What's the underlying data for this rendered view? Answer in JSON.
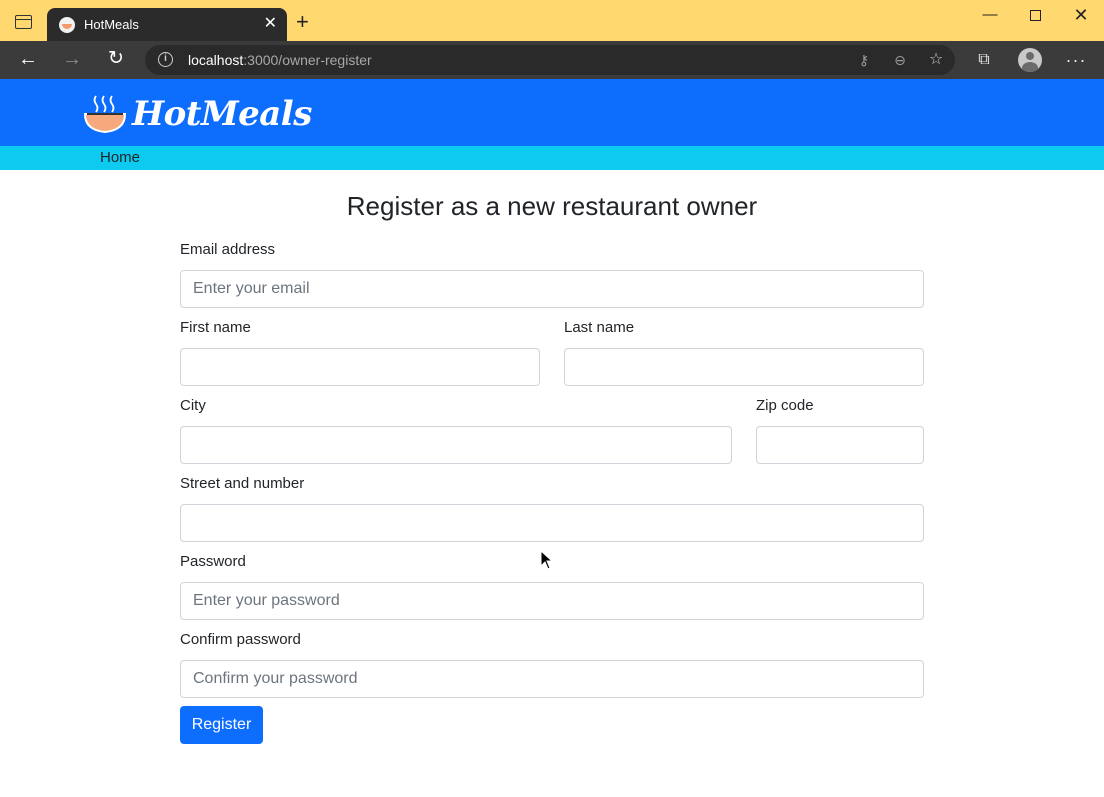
{
  "browser": {
    "tab_title": "HotMeals",
    "url_host": "localhost",
    "url_path": ":3000/owner-register"
  },
  "site": {
    "brand": "HotMeals",
    "nav": [
      {
        "label": "Home"
      }
    ]
  },
  "form": {
    "title": "Register as a new restaurant owner",
    "email": {
      "label": "Email address",
      "placeholder": "Enter your email"
    },
    "first_name": {
      "label": "First name",
      "placeholder": ""
    },
    "last_name": {
      "label": "Last name",
      "placeholder": ""
    },
    "city": {
      "label": "City",
      "placeholder": ""
    },
    "zip": {
      "label": "Zip code",
      "placeholder": ""
    },
    "street": {
      "label": "Street and number",
      "placeholder": ""
    },
    "password": {
      "label": "Password",
      "placeholder": "Enter your password"
    },
    "confirm_password": {
      "label": "Confirm password",
      "placeholder": "Confirm your password"
    },
    "submit_label": "Register"
  },
  "colors": {
    "tabstrip": "#ffd970",
    "header": "#0d6efd",
    "subnav": "#0dcaf0",
    "primary_button": "#0d6efd"
  }
}
